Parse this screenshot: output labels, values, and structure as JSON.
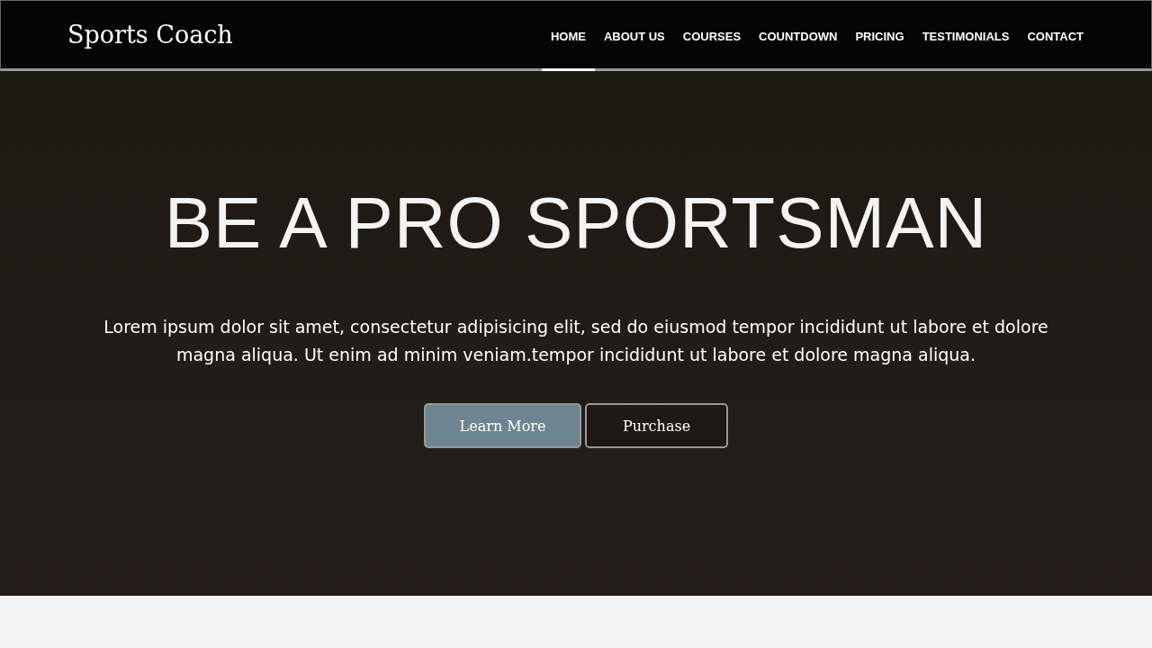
{
  "header": {
    "logo": "Sports Coach",
    "nav": [
      {
        "label": "HOME",
        "selected": true
      },
      {
        "label": "ABOUT US",
        "selected": false
      },
      {
        "label": "COURSES",
        "selected": false
      },
      {
        "label": "COUNTDOWN",
        "selected": false
      },
      {
        "label": "PRICING",
        "selected": false
      },
      {
        "label": "TESTIMONIALS",
        "selected": false
      },
      {
        "label": "CONTACT",
        "selected": false
      }
    ]
  },
  "hero": {
    "title": "BE A PRO SPORTSMAN",
    "text": "Lorem ipsum dolor sit amet, consectetur adipisicing elit, sed do eiusmod tempor incididunt ut labore et dolore magna aliqua. Ut enim ad minim veniam.tempor incididunt ut labore et dolore magna aliqua.",
    "buttons": [
      {
        "label": "Learn More",
        "kind": "primary"
      },
      {
        "label": "Purchase",
        "kind": "outline"
      }
    ]
  }
}
